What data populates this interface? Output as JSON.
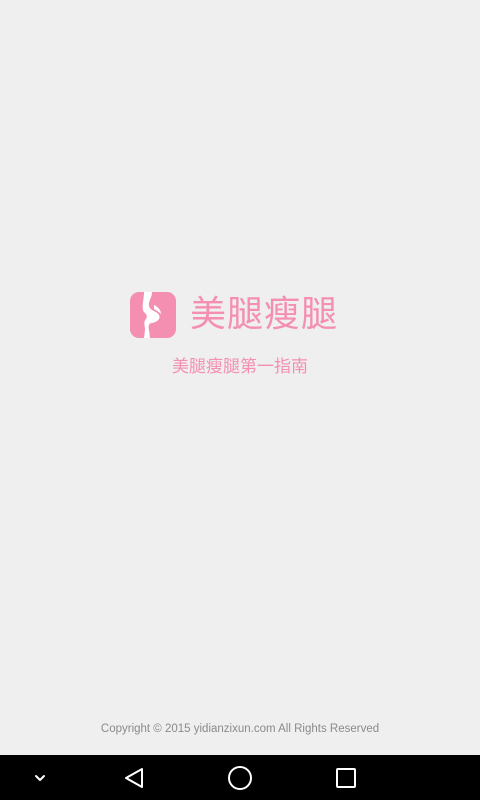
{
  "app": {
    "title": "美腿瘦腿",
    "tagline": "美腿瘦腿第一指南",
    "brand_color": "#f48fb1",
    "icon": "leg-silhouette-icon"
  },
  "footer": {
    "copyright": "Copyright © 2015 yidianzixun.com All Rights Reserved"
  },
  "navbar": {
    "buttons": [
      {
        "name": "hide-keyboard",
        "icon": "chevron-down-icon"
      },
      {
        "name": "back",
        "icon": "back-triangle-icon"
      },
      {
        "name": "home",
        "icon": "home-circle-icon"
      },
      {
        "name": "recents",
        "icon": "recents-square-icon"
      }
    ]
  }
}
